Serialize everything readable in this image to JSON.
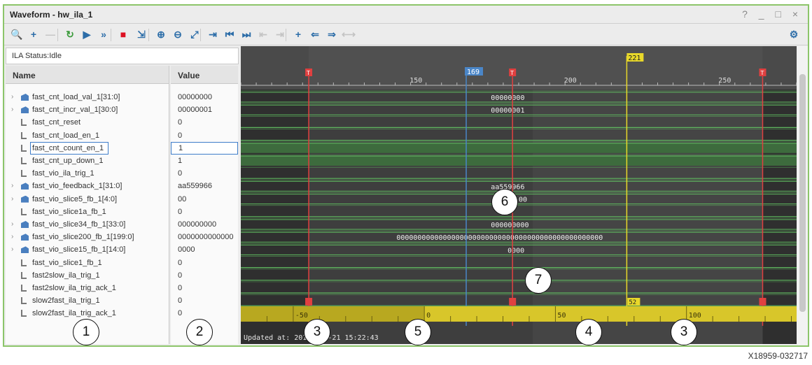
{
  "window": {
    "title": "Waveform - hw_ila_1",
    "controls": "? _ □ ×"
  },
  "toolbar": [
    {
      "icon": "zoom-search-icon",
      "glyph": "🔍"
    },
    {
      "icon": "add-icon",
      "glyph": "+"
    },
    {
      "icon": "remove-icon",
      "glyph": "—",
      "disabled": true
    },
    {
      "icon": "run-trigger-immediate-icon",
      "glyph": "↻"
    },
    {
      "icon": "run-trigger-icon",
      "glyph": "▶"
    },
    {
      "icon": "run-continuous-icon",
      "glyph": "»"
    },
    {
      "icon": "stop-icon",
      "glyph": "■"
    },
    {
      "icon": "export-icon",
      "glyph": "⇲"
    },
    {
      "icon": "zoom-in-icon",
      "glyph": "⊕"
    },
    {
      "icon": "zoom-out-icon",
      "glyph": "⊖"
    },
    {
      "icon": "zoom-fit-icon",
      "glyph": "⤢"
    },
    {
      "icon": "goto-cursor-icon",
      "glyph": "⇥"
    },
    {
      "icon": "goto-time-zero-icon",
      "glyph": "⏮"
    },
    {
      "icon": "goto-last-time-icon",
      "glyph": "⏭"
    },
    {
      "icon": "previous-transition-icon",
      "glyph": "⇤",
      "disabled": true
    },
    {
      "icon": "next-transition-icon",
      "glyph": "⇥",
      "disabled": true
    },
    {
      "icon": "add-marker-icon",
      "glyph": "+"
    },
    {
      "icon": "previous-marker-icon",
      "glyph": "⇐"
    },
    {
      "icon": "next-marker-icon",
      "glyph": "⇒"
    },
    {
      "icon": "swap-cursors-icon",
      "glyph": "⟷",
      "disabled": true
    },
    {
      "icon": "settings-gear-icon",
      "glyph": "⚙"
    }
  ],
  "ila_status": "ILA Status:Idle",
  "columns": {
    "name": "Name",
    "value": "Value"
  },
  "signals": [
    {
      "name": "fast_cnt_load_val_1[31:0]",
      "value": "00000000",
      "bus": true,
      "wave": "00000000",
      "wave_x": 0.45
    },
    {
      "name": "fast_cnt_incr_val_1[30:0]",
      "value": "00000001",
      "bus": true,
      "wave": "00000001",
      "wave_x": 0.45
    },
    {
      "name": "fast_cnt_reset",
      "value": "0",
      "bus": false,
      "wave": "",
      "level": 0
    },
    {
      "name": "fast_cnt_load_en_1",
      "value": "0",
      "bus": false,
      "wave": "",
      "level": 0
    },
    {
      "name": "fast_cnt_count_en_1",
      "value": "1",
      "bus": false,
      "wave": "",
      "level": 1,
      "selected": true
    },
    {
      "name": "fast_cnt_up_down_1",
      "value": "1",
      "bus": false,
      "wave": "",
      "level": 1
    },
    {
      "name": "fast_vio_ila_trig_1",
      "value": "0",
      "bus": false,
      "wave": "",
      "level": 0
    },
    {
      "name": "fast_vio_feedback_1[31:0]",
      "value": "aa559966",
      "bus": true,
      "wave": "aa559966",
      "wave_x": 0.45
    },
    {
      "name": "fast_vio_slice5_fb_1[4:0]",
      "value": "00",
      "bus": true,
      "wave": "00",
      "wave_x": 0.5
    },
    {
      "name": "fast_vio_slice1a_fb_1",
      "value": "0",
      "bus": false,
      "wave": "",
      "level": 0
    },
    {
      "name": "fast_vio_slice34_fb_1[33:0]",
      "value": "000000000",
      "bus": true,
      "wave": "000000000",
      "wave_x": 0.45
    },
    {
      "name": "fast_vio_slice200_fb_1[199:0]",
      "value": "0000000000000",
      "bus": true,
      "wave": "0000000000000000000000000000000000000000000000000",
      "wave_x": 0.28
    },
    {
      "name": "fast_vio_slice15_fb_1[14:0]",
      "value": "0000",
      "bus": true,
      "wave": "0000",
      "wave_x": 0.48
    },
    {
      "name": "fast_vio_slice1_fb_1",
      "value": "0",
      "bus": false,
      "wave": "",
      "level": 0
    },
    {
      "name": "fast2slow_ila_trig_1",
      "value": "0",
      "bus": false,
      "wave": "",
      "level": 0
    },
    {
      "name": "fast2slow_ila_trig_ack_1",
      "value": "0",
      "bus": false,
      "wave": "",
      "level": 0
    },
    {
      "name": "slow2fast_ila_trig_1",
      "value": "0",
      "bus": false,
      "wave": "",
      "level": 0
    },
    {
      "name": "slow2fast_ila_trig_ack_1",
      "value": "0",
      "bus": false,
      "wave": "",
      "level": 0
    }
  ],
  "timeline": {
    "ticks": [
      "150",
      "200",
      "250"
    ],
    "tick_values": [
      150,
      200,
      250
    ],
    "range": [
      96,
      276
    ],
    "cursor_label": "169",
    "cursor_value": 169,
    "marker_label": "221",
    "marker_value": 221,
    "trigger_values": [
      118,
      184,
      265
    ],
    "trigger_glyph": "T"
  },
  "window_bar": {
    "ticks": [
      "-50",
      "0",
      "50",
      "100"
    ],
    "tick_values": [
      -50,
      0,
      50,
      100
    ],
    "range": [
      -70,
      142
    ],
    "marker_label": "52",
    "marker_value": 52
  },
  "updated_text": "Updated at: 2017-Mar-21 15:22:43",
  "callouts": [
    "1",
    "2",
    "3",
    "5",
    "4",
    "3",
    "6",
    "7"
  ],
  "figure_id": "X18959-032717",
  "colors": {
    "frame": "#8cc56a",
    "cursor": "#4a86c8",
    "marker": "#e8d82a",
    "trigger": "#e04040",
    "wave_green": "#5fb85f"
  }
}
